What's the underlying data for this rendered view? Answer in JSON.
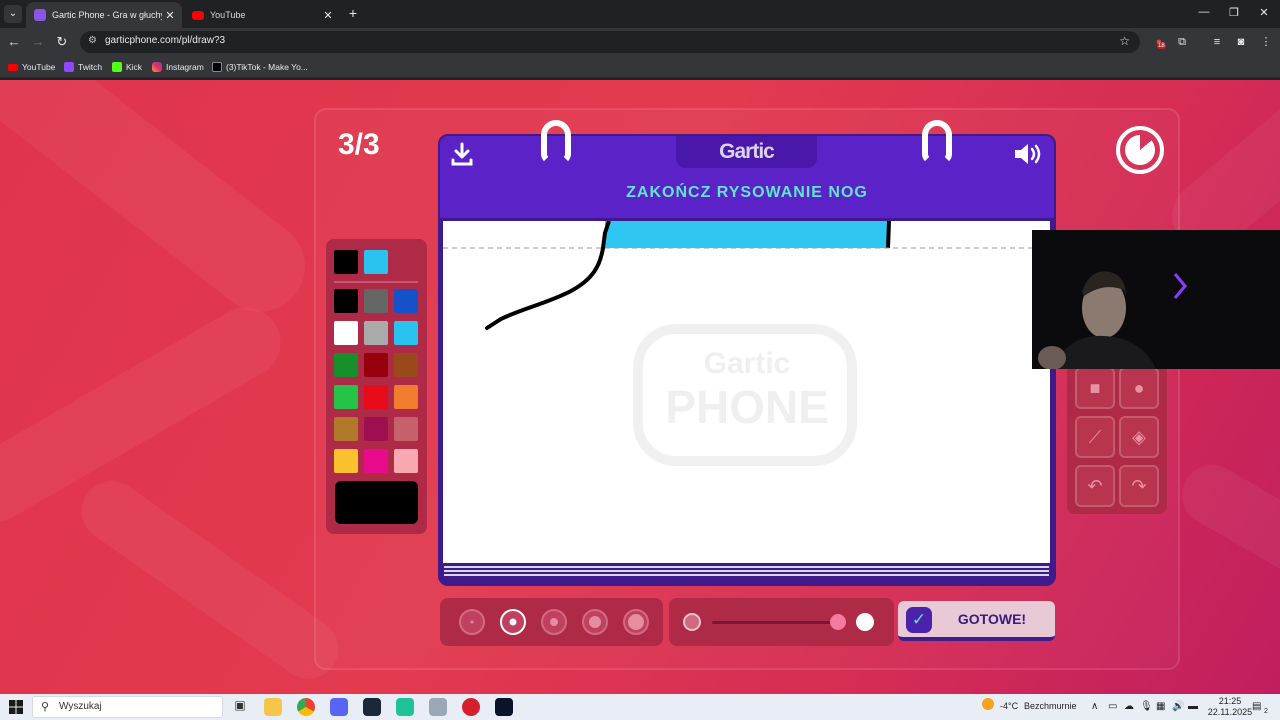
{
  "browser": {
    "tabs": [
      {
        "title": "Gartic Phone - Gra w głuchy tel",
        "active": true,
        "favicon_color": "#8a56e2"
      },
      {
        "title": "YouTube",
        "active": false,
        "favicon_color": "#ff0000"
      }
    ],
    "url": "garticphone.com/pl/draw?3",
    "bookmarks": [
      {
        "label": "YouTube",
        "icon_color": "#ff0000"
      },
      {
        "label": "Twitch",
        "icon_color": "#9146ff"
      },
      {
        "label": "Kick",
        "icon_color": "#53fc18"
      },
      {
        "label": "Instagram",
        "icon_color": "#e1306c"
      },
      {
        "label": "(3)TikTok - Make Yo...",
        "icon_color": "#ffffff"
      }
    ],
    "extension_badge": "18"
  },
  "game": {
    "round": "3/3",
    "logo": "Gartic",
    "prompt": "ZAKOŃCZ RYSOWANIE NOG",
    "watermark_top": "Gartic",
    "watermark_bottom": "PHONE",
    "timer_elapsed_fraction": 0.86,
    "done_label": "GOTOWE!",
    "current_color": "#000000",
    "palette_recent": [
      "#000000",
      "#2ac3f0"
    ],
    "palette": [
      [
        "#000000",
        "#666666",
        "#1552c9"
      ],
      [
        "#ffffff",
        "#aaaaaa",
        "#2ac3f0"
      ],
      [
        "#178f2b",
        "#98000d",
        "#9a4a1a"
      ],
      [
        "#26c446",
        "#e80c1a",
        "#f27c2e"
      ],
      [
        "#b07a2a",
        "#9d0f4f",
        "#c6616c"
      ],
      [
        "#fbc02d",
        "#ea0a8c",
        "#f7a8b1"
      ]
    ],
    "brush_sizes": [
      "size-1",
      "size-2",
      "size-3",
      "size-4",
      "size-5"
    ],
    "selected_brush_size": 1,
    "tools": [
      "rectangle",
      "ellipse",
      "line",
      "fill",
      "undo",
      "redo"
    ],
    "opacity_value": 1.0
  },
  "taskbar": {
    "search_placeholder": "Wyszukaj",
    "weather_temp": "-4°C",
    "weather_text": "Bezchmurnie",
    "time": "21:25",
    "date": "22.11.2025",
    "notification_count": "2"
  }
}
